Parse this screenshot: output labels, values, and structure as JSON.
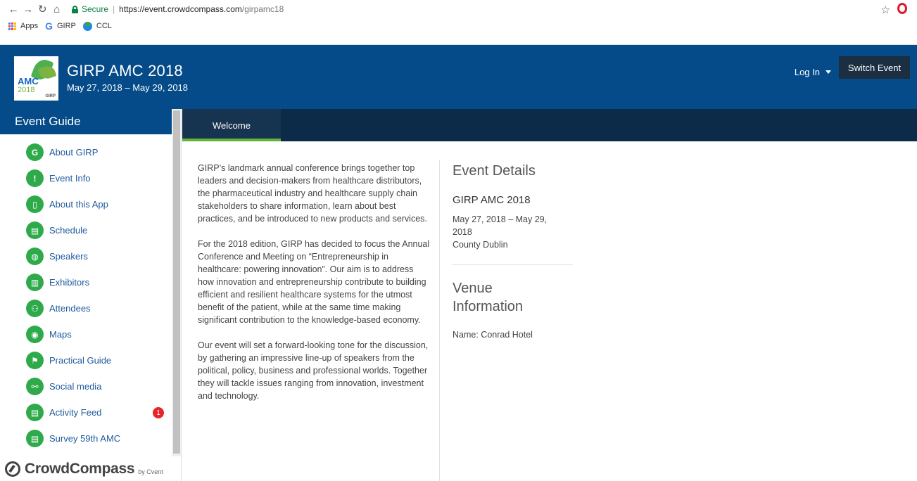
{
  "browser": {
    "secure_label": "Secure",
    "url_host": "https://event.crowdcompass.com",
    "url_path": "/girpamc18",
    "bookmarks": [
      "Apps",
      "GIRP",
      "CCL"
    ]
  },
  "header": {
    "logo": {
      "line1": "AMC",
      "line2": "2018",
      "small": "GIRP"
    },
    "title": "GIRP AMC 2018",
    "dates": "May 27, 2018 – May 29, 2018",
    "login_label": "Log In",
    "switch_label": "Switch Event"
  },
  "sidebar": {
    "title": "Event Guide",
    "items": [
      {
        "label": "About GIRP",
        "icon": "G"
      },
      {
        "label": "Event Info",
        "icon": "!"
      },
      {
        "label": "About this App",
        "icon": "▯"
      },
      {
        "label": "Schedule",
        "icon": "▤"
      },
      {
        "label": "Speakers",
        "icon": "◍"
      },
      {
        "label": "Exhibitors",
        "icon": "▥"
      },
      {
        "label": "Attendees",
        "icon": "⚇"
      },
      {
        "label": "Maps",
        "icon": "◉"
      },
      {
        "label": "Practical Guide",
        "icon": "⚑"
      },
      {
        "label": "Social media",
        "icon": "⚯"
      },
      {
        "label": "Activity Feed",
        "icon": "▤",
        "badge": "1"
      },
      {
        "label": "Survey 59th AMC",
        "icon": "▤"
      }
    ],
    "footer_brand": "CrowdCompass",
    "footer_by": "by Cvent"
  },
  "tabs": [
    {
      "label": "Welcome"
    }
  ],
  "content": {
    "paragraphs": [
      "GIRP’s landmark annual conference brings together top leaders and decision-makers from healthcare distributors, the pharmaceutical industry and healthcare supply chain stakeholders to share information, learn about best practices, and be introduced to new products and services.",
      "For the 2018 edition, GIRP has decided to focus the Annual Conference and Meeting on “Entrepreneurship in healthcare: powering innovation”. Our aim is to address how innovation and entrepreneurship contribute to building efficient and resilient healthcare systems for the utmost benefit of the patient, while at the same time making significant contribution to the knowledge-based economy.",
      "Our event will set a forward-looking tone for the discussion, by gathering an impressive line-up of speakers from the political, policy, business and professional worlds. Together they will tackle issues ranging from innovation, investment and technology."
    ]
  },
  "details": {
    "heading": "Event Details",
    "event_name": "GIRP AMC 2018",
    "dates": "May 27, 2018 – May 29, 2018",
    "location": "County Dublin",
    "venue_heading": "Venue Information",
    "venue_name": "Name: Conrad Hotel"
  }
}
